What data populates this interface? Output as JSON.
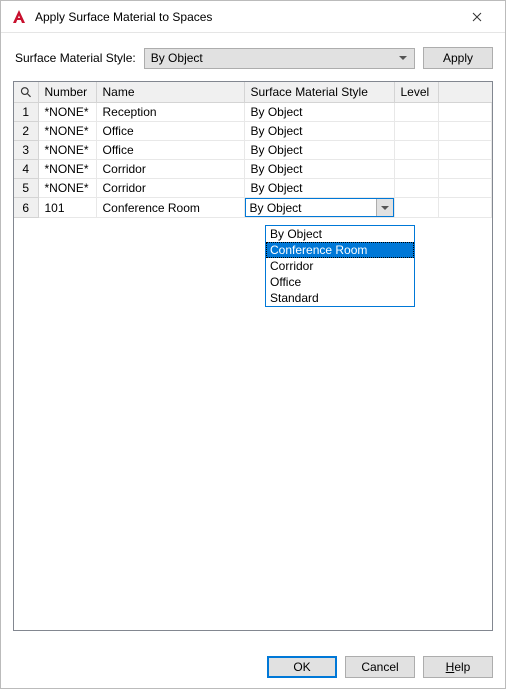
{
  "window": {
    "title": "Apply Surface Material to Spaces"
  },
  "toolbar": {
    "style_label": "Surface Material Style:",
    "style_value": "By Object",
    "apply_label": "Apply"
  },
  "grid": {
    "headers": {
      "number": "Number",
      "name": "Name",
      "style": "Surface Material Style",
      "level": "Level"
    },
    "rows": [
      {
        "idx": "1",
        "number": "*NONE*",
        "name": "Reception",
        "style": "By Object",
        "level": ""
      },
      {
        "idx": "2",
        "number": "*NONE*",
        "name": "Office",
        "style": "By Object",
        "level": ""
      },
      {
        "idx": "3",
        "number": "*NONE*",
        "name": "Office",
        "style": "By Object",
        "level": ""
      },
      {
        "idx": "4",
        "number": "*NONE*",
        "name": "Corridor",
        "style": "By Object",
        "level": ""
      },
      {
        "idx": "5",
        "number": "*NONE*",
        "name": "Corridor",
        "style": "By Object",
        "level": ""
      },
      {
        "idx": "6",
        "number": "101",
        "name": "Conference Room",
        "style": "By Object",
        "level": ""
      }
    ]
  },
  "dropdown": {
    "options": [
      "By Object",
      "Conference Room",
      "Corridor",
      "Office",
      "Standard"
    ],
    "selected": "Conference Room"
  },
  "footer": {
    "ok": "OK",
    "cancel": "Cancel",
    "help": "Help"
  }
}
